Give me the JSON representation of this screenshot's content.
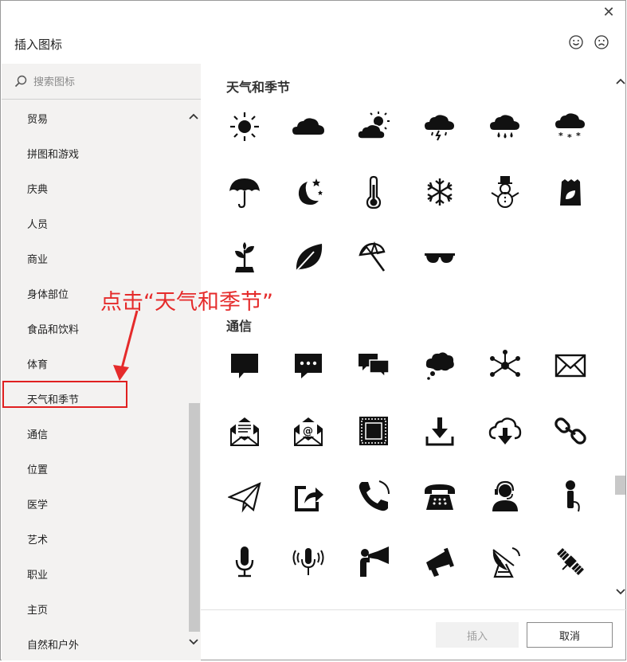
{
  "window": {
    "title": "插入图标",
    "close_glyph": "✕"
  },
  "search": {
    "placeholder": "搜索图标"
  },
  "categories": [
    "贸易",
    "拼图和游戏",
    "庆典",
    "人员",
    "商业",
    "身体部位",
    "食品和饮料",
    "体育",
    "天气和季节",
    "通信",
    "位置",
    "医学",
    "艺术",
    "职业",
    "主页",
    "自然和户外"
  ],
  "selected_category": "天气和季节",
  "sections": [
    {
      "title": "天气和季节",
      "icons": [
        "sun-icon",
        "cloud-icon",
        "partly-sunny-icon",
        "thunderstorm-icon",
        "rain-icon",
        "snow-icon",
        "umbrella-icon",
        "moon-stars-icon",
        "thermometer-icon",
        "snowflake-icon",
        "snowman-icon",
        "seed-bag-icon",
        "seedling-icon",
        "leaf-icon",
        "beach-umbrella-icon",
        "sunglasses-icon"
      ]
    },
    {
      "title": "通信",
      "icons": [
        "speech-bubble-icon",
        "chat-dots-icon",
        "conversation-icon",
        "thought-bubble-icon",
        "network-icon",
        "envelope-icon",
        "open-letter-icon",
        "email-at-icon",
        "stamp-icon",
        "download-icon",
        "cloud-download-icon",
        "link-icon",
        "paper-plane-icon",
        "share-icon",
        "phone-handset-icon",
        "desk-phone-icon",
        "headset-user-icon",
        "handheld-mic-icon",
        "microphone-icon",
        "broadcast-mic-icon",
        "megaphone-person-icon",
        "megaphone-icon",
        "satellite-dish-icon",
        "satellite-icon"
      ]
    }
  ],
  "buttons": {
    "insert": "插入",
    "cancel": "取消"
  },
  "annotation": {
    "text": "点击“天气和季节”",
    "color": "#e52b2b"
  }
}
